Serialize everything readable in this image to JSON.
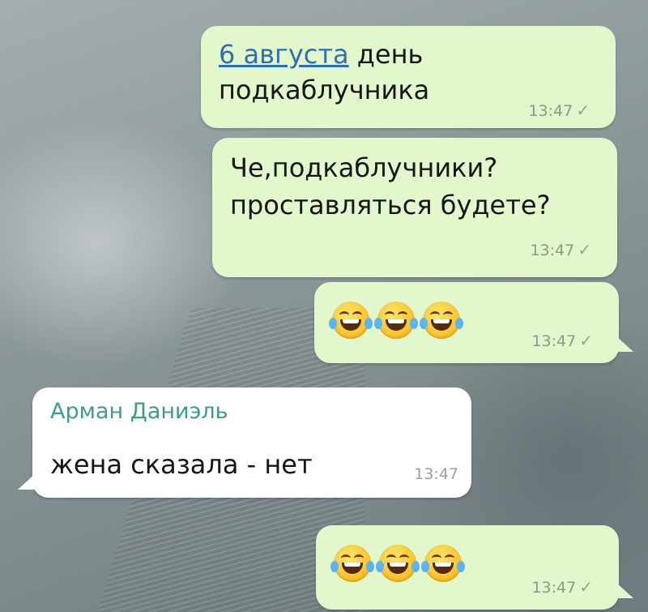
{
  "messages": [
    {
      "direction": "outgoing",
      "link_text": "6 августа",
      "text_rest": " день",
      "text_line2": "подкаблучника",
      "time": "13:47",
      "status_icon": "single-check-icon"
    },
    {
      "direction": "outgoing",
      "text_line1": "Че,подкаблучники?",
      "text_line2": "проставляться будете?",
      "time": "13:47",
      "status_icon": "single-check-icon"
    },
    {
      "direction": "outgoing",
      "emoji": [
        "face-with-tears-of-joy-icon",
        "face-with-tears-of-joy-icon",
        "face-with-tears-of-joy-icon"
      ],
      "time": "13:47",
      "status_icon": "single-check-icon"
    },
    {
      "direction": "incoming",
      "sender": "Арман Даниэль",
      "text": "жена сказала - нет",
      "time": "13:47"
    },
    {
      "direction": "outgoing",
      "emoji": [
        "face-with-tears-of-joy-icon",
        "face-with-tears-of-joy-icon",
        "face-with-tears-of-joy-icon"
      ],
      "time": "13:47",
      "status_icon": "single-check-icon"
    }
  ],
  "colors": {
    "outgoing_bubble": "#e2f7cb",
    "incoming_bubble": "#ffffff",
    "sender_name": "#3e9c8a",
    "link": "#2f6db5"
  }
}
